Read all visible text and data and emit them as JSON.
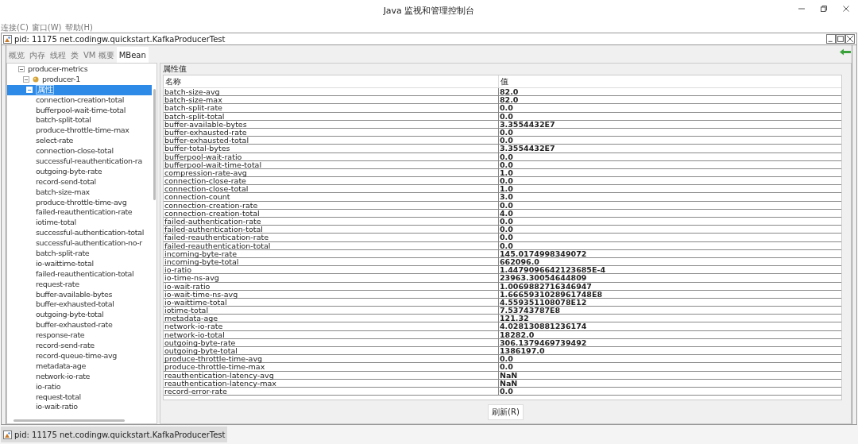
{
  "window": {
    "title": "Java 监视和管理控制台"
  },
  "menu": [
    "连接(C)",
    "窗口(W)",
    "帮助(H)"
  ],
  "inner_window": {
    "title": "pid: 11175 net.codingw.quickstart.KafkaProducerTest"
  },
  "tabs": [
    {
      "label": "概览",
      "selected": false
    },
    {
      "label": "内存",
      "selected": false
    },
    {
      "label": "线程",
      "selected": false
    },
    {
      "label": "类",
      "selected": false
    },
    {
      "label": "VM 概要",
      "selected": false
    },
    {
      "label": "MBean",
      "selected": true
    }
  ],
  "tree": [
    {
      "label": "producer-metrics",
      "expanded": true,
      "selected": false,
      "children": [
        {
          "label": "producer-1",
          "expanded": true,
          "selected": false,
          "children": [
            {
              "label": "属性",
              "expanded": true,
              "selected": true,
              "children": [
                {
                  "label": "connection-creation-total"
                },
                {
                  "label": "bufferpool-wait-time-total"
                },
                {
                  "label": "batch-split-total"
                },
                {
                  "label": "produce-throttle-time-max"
                },
                {
                  "label": "select-rate"
                },
                {
                  "label": "connection-close-total"
                },
                {
                  "label": "successful-reauthentication-ra"
                },
                {
                  "label": "outgoing-byte-rate"
                },
                {
                  "label": "record-send-total"
                },
                {
                  "label": "batch-size-max"
                },
                {
                  "label": "produce-throttle-time-avg"
                },
                {
                  "label": "failed-reauthentication-rate"
                },
                {
                  "label": "iotime-total"
                },
                {
                  "label": "successful-authentication-total"
                },
                {
                  "label": "successful-authentication-no-r"
                },
                {
                  "label": "batch-split-rate"
                },
                {
                  "label": "io-waittime-total"
                },
                {
                  "label": "failed-reauthentication-total"
                },
                {
                  "label": "request-rate"
                },
                {
                  "label": "buffer-available-bytes"
                },
                {
                  "label": "buffer-exhausted-total"
                },
                {
                  "label": "outgoing-byte-total"
                },
                {
                  "label": "buffer-exhausted-rate"
                },
                {
                  "label": "response-rate"
                },
                {
                  "label": "record-send-rate"
                },
                {
                  "label": "record-queue-time-avg"
                },
                {
                  "label": "metadata-age"
                },
                {
                  "label": "network-io-rate"
                },
                {
                  "label": "io-ratio"
                },
                {
                  "label": "request-total"
                },
                {
                  "label": "io-wait-ratio"
                }
              ]
            }
          ]
        }
      ]
    }
  ],
  "attributes": {
    "title": "属性值",
    "columns": [
      "名称",
      "值"
    ],
    "rows": [
      [
        "batch-size-avg",
        "82.0"
      ],
      [
        "batch-size-max",
        "82.0"
      ],
      [
        "batch-split-rate",
        "0.0"
      ],
      [
        "batch-split-total",
        "0.0"
      ],
      [
        "buffer-available-bytes",
        "3.3554432E7"
      ],
      [
        "buffer-exhausted-rate",
        "0.0"
      ],
      [
        "buffer-exhausted-total",
        "0.0"
      ],
      [
        "buffer-total-bytes",
        "3.3554432E7"
      ],
      [
        "bufferpool-wait-ratio",
        "0.0"
      ],
      [
        "bufferpool-wait-time-total",
        "0.0"
      ],
      [
        "compression-rate-avg",
        "1.0"
      ],
      [
        "connection-close-rate",
        "0.0"
      ],
      [
        "connection-close-total",
        "1.0"
      ],
      [
        "connection-count",
        "3.0"
      ],
      [
        "connection-creation-rate",
        "0.0"
      ],
      [
        "connection-creation-total",
        "4.0"
      ],
      [
        "failed-authentication-rate",
        "0.0"
      ],
      [
        "failed-authentication-total",
        "0.0"
      ],
      [
        "failed-reauthentication-rate",
        "0.0"
      ],
      [
        "failed-reauthentication-total",
        "0.0"
      ],
      [
        "incoming-byte-rate",
        "145.0174998349072"
      ],
      [
        "incoming-byte-total",
        "662096.0"
      ],
      [
        "io-ratio",
        "1.4479096642123685E-4"
      ],
      [
        "io-time-ns-avg",
        "23963.30054644809"
      ],
      [
        "io-wait-ratio",
        "1.0069882716346947"
      ],
      [
        "io-wait-time-ns-avg",
        "1.6665931028961748E8"
      ],
      [
        "io-waittime-total",
        "4.559351108078E12"
      ],
      [
        "iotime-total",
        "7.53743787E8"
      ],
      [
        "metadata-age",
        "121.32"
      ],
      [
        "network-io-rate",
        "4.028130881236174"
      ],
      [
        "network-io-total",
        "18282.0"
      ],
      [
        "outgoing-byte-rate",
        "306.1379469739492"
      ],
      [
        "outgoing-byte-total",
        "1386197.0"
      ],
      [
        "produce-throttle-time-avg",
        "0.0"
      ],
      [
        "produce-throttle-time-max",
        "0.0"
      ],
      [
        "reauthentication-latency-avg",
        "NaN"
      ],
      [
        "reauthentication-latency-max",
        "NaN"
      ],
      [
        "record-error-rate",
        "0.0"
      ]
    ],
    "button": "刷新(R)"
  },
  "taskbar": [
    {
      "label": "pid: 11175 net.codingw.quickstart.KafkaProducerTest",
      "selected": true
    }
  ]
}
